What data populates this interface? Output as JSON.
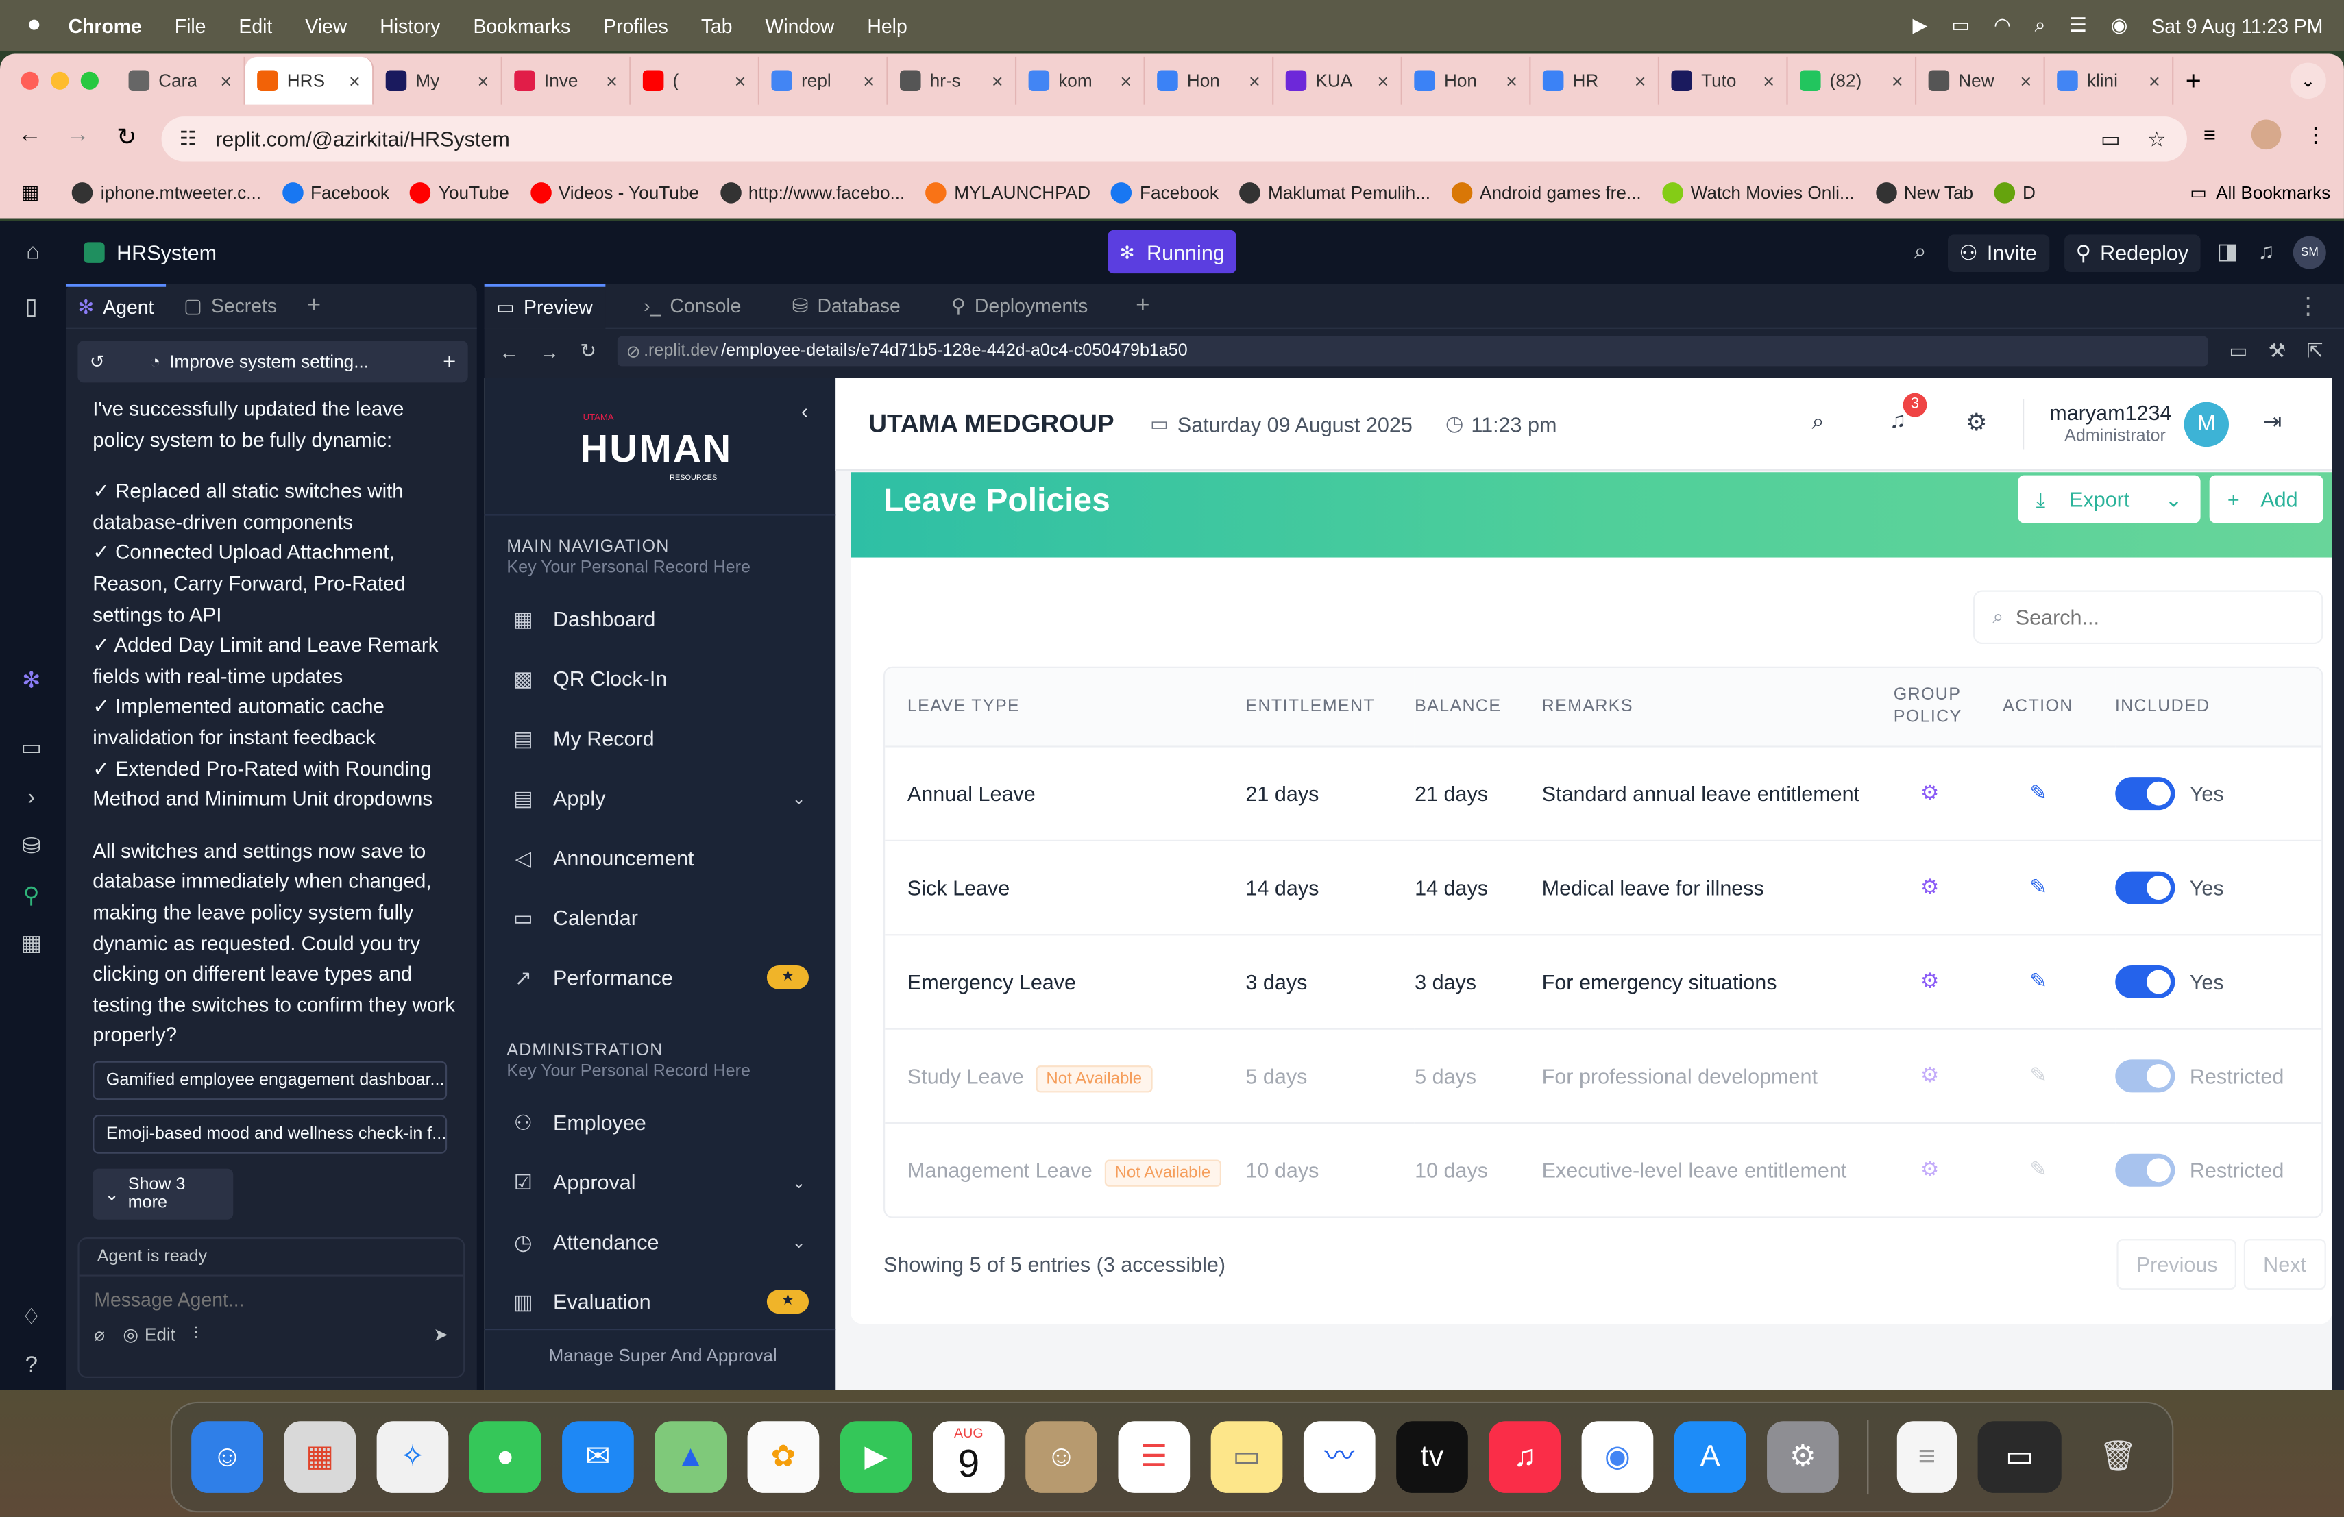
{
  "menubar": {
    "app": "Chrome",
    "items": [
      "File",
      "Edit",
      "View",
      "History",
      "Bookmarks",
      "Profiles",
      "Tab",
      "Window",
      "Help"
    ],
    "datetime": "Sat 9 Aug  11:23 PM"
  },
  "browser": {
    "tabs": [
      {
        "label": "Cara",
        "color": "#666"
      },
      {
        "label": "HRS",
        "color": "#f26207"
      },
      {
        "label": "My",
        "color": "#1a1a5e"
      },
      {
        "label": "Inve",
        "color": "#e11d48"
      },
      {
        "label": "(",
        "color": "#ff0000"
      },
      {
        "label": "repl",
        "color": "#4285f4"
      },
      {
        "label": "hr-s",
        "color": "#555"
      },
      {
        "label": "kom",
        "color": "#4285f4"
      },
      {
        "label": "Hon",
        "color": "#3b82f6"
      },
      {
        "label": "KUA",
        "color": "#6d28d9"
      },
      {
        "label": "Hon",
        "color": "#3b82f6"
      },
      {
        "label": "HR",
        "color": "#3b82f6"
      },
      {
        "label": "Tuto",
        "color": "#1a1a5e"
      },
      {
        "label": "(82)",
        "color": "#22c55e"
      },
      {
        "label": "New",
        "color": "#555"
      },
      {
        "label": "klini",
        "color": "#4285f4"
      }
    ],
    "url": "replit.com/@azirkitai/HRSystem",
    "bookmarks": [
      {
        "label": "iphone.mtweeter.c...",
        "color": "#333"
      },
      {
        "label": "Facebook",
        "color": "#1877f2"
      },
      {
        "label": "YouTube",
        "color": "#ff0000"
      },
      {
        "label": "Videos - YouTube",
        "color": "#ff0000"
      },
      {
        "label": "http://www.facebo...",
        "color": "#333"
      },
      {
        "label": "MYLAUNCHPAD",
        "color": "#f97316"
      },
      {
        "label": "Facebook",
        "color": "#1877f2"
      },
      {
        "label": "Maklumat Pemulih...",
        "color": "#333"
      },
      {
        "label": "Android games fre...",
        "color": "#d97706"
      },
      {
        "label": "Watch Movies Onli...",
        "color": "#84cc16"
      },
      {
        "label": "New Tab",
        "color": "#333"
      },
      {
        "label": "D",
        "color": "#65a30d"
      }
    ],
    "all_bookmarks": "All Bookmarks"
  },
  "replit": {
    "project": "HRSystem",
    "status": "Running",
    "invite": "Invite",
    "redeploy": "Redeploy",
    "avatar": "SM",
    "agent_tabs": [
      "Agent",
      "Secrets"
    ],
    "thread_title": "Improve system setting...",
    "message_p1": "I've successfully updated the leave policy system to be fully dynamic:",
    "checklist": [
      "✓ Replaced all static switches with database-driven components",
      "✓ Connected Upload Attachment, Reason, Carry Forward, Pro-Rated settings to API",
      "✓ Added Day Limit and Leave Remark fields with real-time updates",
      "✓ Implemented automatic cache invalidation for instant feedback",
      "✓ Extended Pro-Rated with Rounding Method and Minimum Unit dropdowns"
    ],
    "message_p2": "All switches and settings now save to database immediately when changed, making the leave policy system fully dynamic as requested. Could you try clicking on different leave types and testing the switches to confirm they work properly?",
    "suggestions": [
      "Gamified employee engagement dashboar...",
      "Emoji-based mood and wellness check-in f..."
    ],
    "show_more": "Show 3 more",
    "agent_status": "Agent is ready",
    "composer_placeholder": "Message Agent...",
    "edit_label": "Edit",
    "preview_tabs": [
      "Preview",
      "Console",
      "Database",
      "Deployments"
    ],
    "preview_url_host": ".replit.dev",
    "preview_url_path": "/employee-details/e74d71b5-128e-442d-a0c4-c050479b1a50"
  },
  "hr": {
    "logo_top": "UTAMA",
    "logo_main": "HUMAN",
    "logo_sub": "RESOURCES",
    "company": "UTAMA MEDGROUP",
    "date": "Saturday 09 August 2025",
    "time": "11:23 pm",
    "notif_count": "3",
    "user_name": "maryam1234",
    "user_role": "Administrator",
    "user_initial": "M",
    "nav_main_title": "MAIN NAVIGATION",
    "nav_main_sub": "Key Your Personal Record Here",
    "nav_main": [
      {
        "label": "Dashboard",
        "icon": "▦"
      },
      {
        "label": "QR Clock-In",
        "icon": "▩"
      },
      {
        "label": "My Record",
        "icon": "▤"
      },
      {
        "label": "Apply",
        "icon": "▤",
        "chev": "⌄"
      },
      {
        "label": "Announcement",
        "icon": "◁"
      },
      {
        "label": "Calendar",
        "icon": "▭"
      },
      {
        "label": "Performance",
        "icon": "↗",
        "star": "★"
      }
    ],
    "nav_admin_title": "ADMINISTRATION",
    "nav_admin_sub": "Key Your Personal Record Here",
    "nav_admin": [
      {
        "label": "Employee",
        "icon": "⚇"
      },
      {
        "label": "Approval",
        "icon": "☑",
        "chev": "⌄"
      },
      {
        "label": "Attendance",
        "icon": "◷",
        "chev": "⌄"
      },
      {
        "label": "Evaluation",
        "icon": "▥",
        "star": "★"
      }
    ],
    "nav_footer": "Manage Super And Approval",
    "page_title": "Leave Policies",
    "export": "Export",
    "add": "Add",
    "search_placeholder": "Search...",
    "columns": [
      "LEAVE TYPE",
      "ENTITLEMENT",
      "BALANCE",
      "REMARKS",
      "GROUP POLICY",
      "ACTION",
      "INCLUDED"
    ],
    "rows": [
      {
        "type": "Annual Leave",
        "entitlement": "21 days",
        "balance": "21 days",
        "remarks": "Standard annual leave entitlement",
        "included": "Yes",
        "badge": ""
      },
      {
        "type": "Sick Leave",
        "entitlement": "14 days",
        "balance": "14 days",
        "remarks": "Medical leave for illness",
        "included": "Yes",
        "badge": ""
      },
      {
        "type": "Emergency Leave",
        "entitlement": "3 days",
        "balance": "3 days",
        "remarks": "For emergency situations",
        "included": "Yes",
        "badge": ""
      },
      {
        "type": "Study Leave",
        "entitlement": "5 days",
        "balance": "5 days",
        "remarks": "For professional development",
        "included": "Restricted",
        "badge": "Not Available"
      },
      {
        "type": "Management Leave",
        "entitlement": "10 days",
        "balance": "10 days",
        "remarks": "Executive-level leave entitlement",
        "included": "Restricted",
        "badge": "Not Available"
      }
    ],
    "footer_text": "Showing 5 of 5 entries (3 accessible)",
    "previous": "Previous",
    "next": "Next",
    "accent": "#2563eb",
    "banner_start": "#2ebfa5"
  },
  "dock": {
    "calendar_month": "AUG",
    "calendar_day": "9"
  }
}
